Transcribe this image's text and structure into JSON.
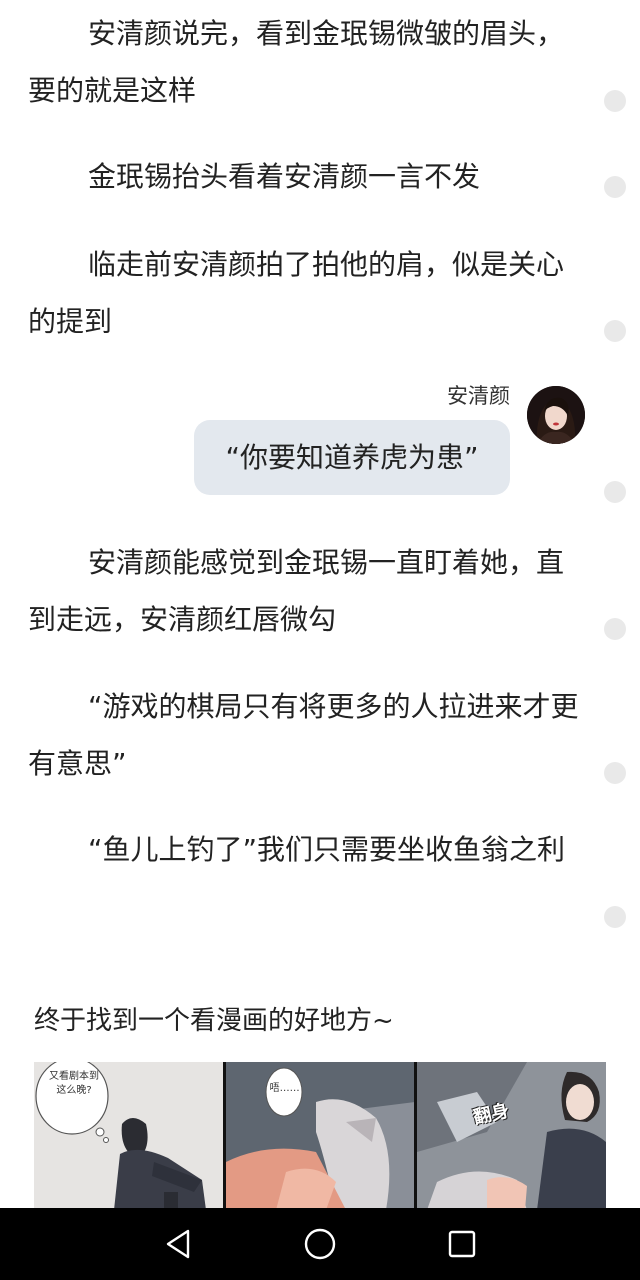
{
  "paragraphs": [
    "安清颜说完，看到金珉锡微皱的眉头，要的就是这样",
    "金珉锡抬头看着安清颜一言不发",
    "临走前安清颜拍了拍他的肩，似是关心的提到",
    "安清颜能感觉到金珉锡一直盯着她，直到走远，安清颜红唇微勾",
    "“游戏的棋局只有将更多的人拉进来才更有意思”",
    "“鱼儿上钓了”我们只需要坐收鱼翁之利"
  ],
  "chat": {
    "speaker": "安清颜",
    "message": "“你要知道养虎为患”"
  },
  "promo": {
    "text": "终于找到一个看漫画的好地方~",
    "bubble1": "又看剧本到这么晚?",
    "bubble2": "唔……",
    "sfx": "翻身"
  },
  "navbar": {
    "back_icon": "triangle-back-icon",
    "home_icon": "circle-home-icon",
    "recents_icon": "square-recents-icon"
  }
}
